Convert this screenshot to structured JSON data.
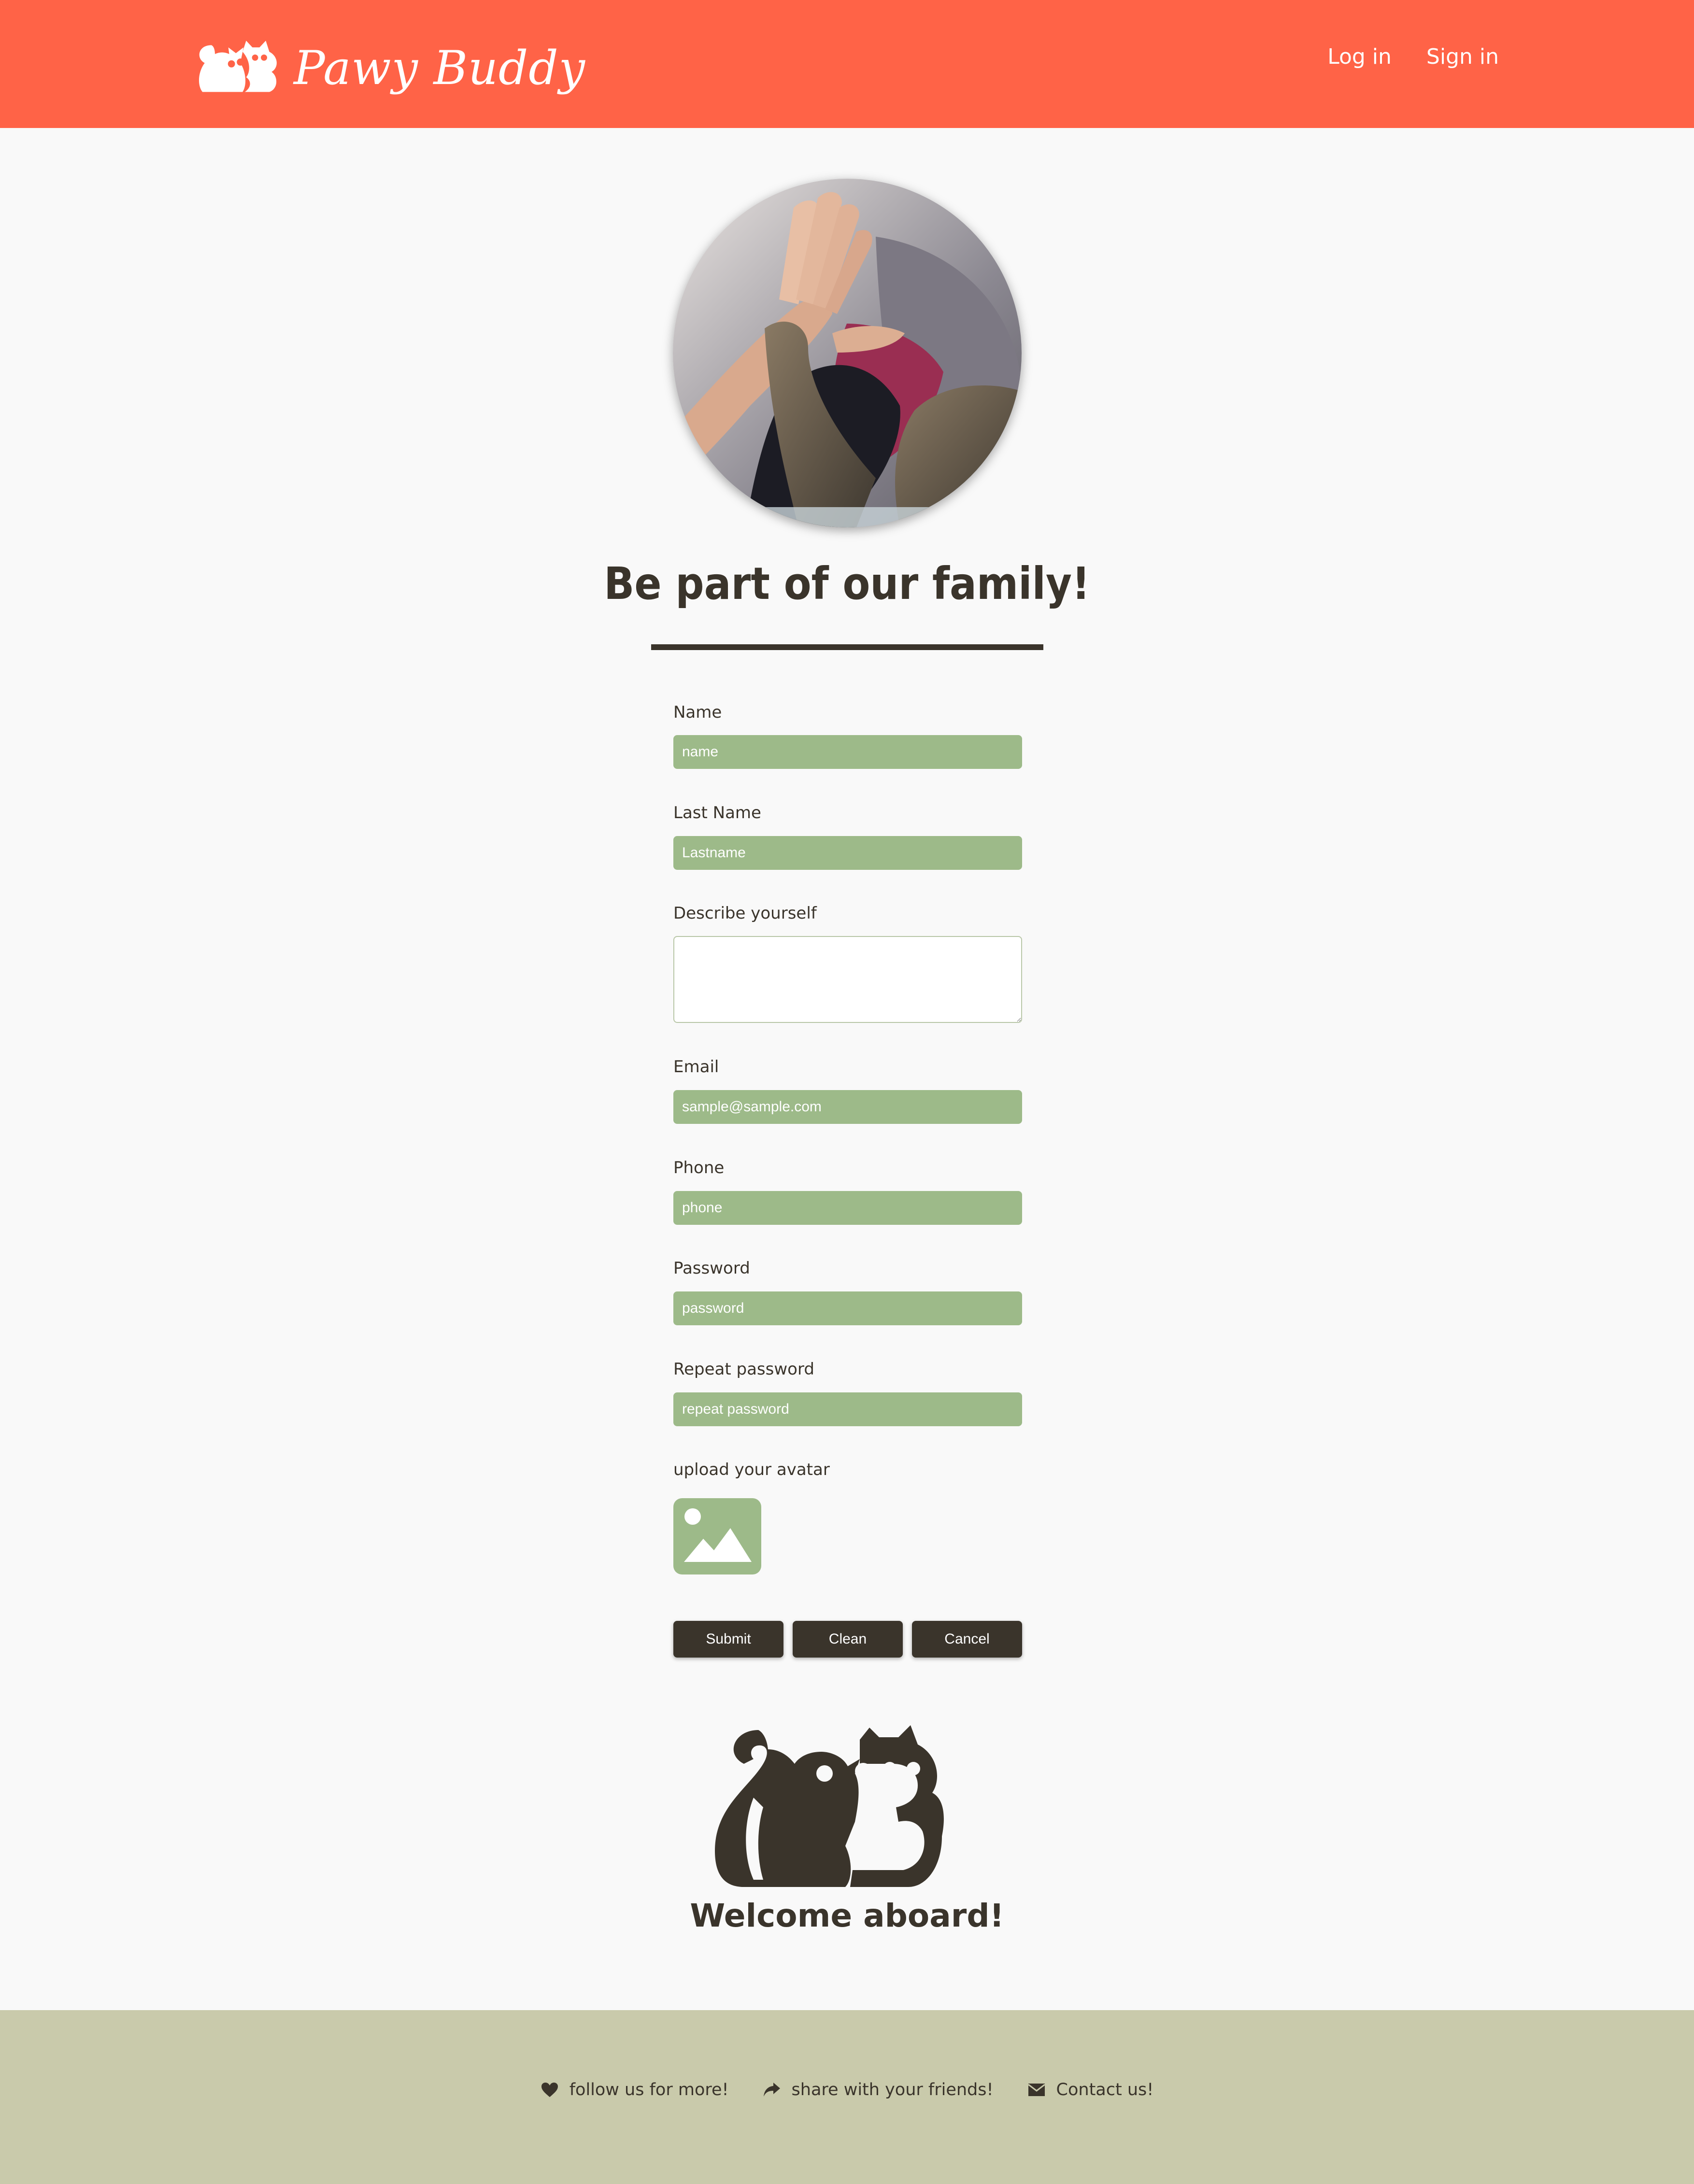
{
  "header": {
    "brand": "Pawy Buddy",
    "nav": {
      "login": "Log in",
      "signin": "Sign in"
    }
  },
  "main": {
    "title": "Be part of our family!",
    "form": {
      "name": {
        "label": "Name",
        "placeholder": "name"
      },
      "lastname": {
        "label": "Last Name",
        "placeholder": "Lastname"
      },
      "describe": {
        "label": "Describe yourself"
      },
      "email": {
        "label": "Email",
        "placeholder": "sample@sample.com"
      },
      "phone": {
        "label": "Phone",
        "placeholder": "phone"
      },
      "password": {
        "label": "Password",
        "placeholder": "password"
      },
      "repeat_password": {
        "label": "Repeat password",
        "placeholder": "repeat password"
      },
      "avatar": {
        "label": "upload your avatar",
        "icon": "image-icon"
      }
    },
    "buttons": {
      "submit": "Submit",
      "clean": "Clean",
      "cancel": "Cancel"
    },
    "welcome": "Welcome aboard!"
  },
  "footer": {
    "links": [
      {
        "icon": "heart-icon",
        "label": "follow us for more!"
      },
      {
        "icon": "share-icon",
        "label": "share with your friends!"
      },
      {
        "icon": "envelope-icon",
        "label": "Contact us!"
      }
    ]
  },
  "colors": {
    "header_bg": "#ff6347",
    "input_bg": "#9dba89",
    "dark": "#3a342b",
    "footer_bg": "#c9caab",
    "page_bg": "#f9f9f9"
  }
}
